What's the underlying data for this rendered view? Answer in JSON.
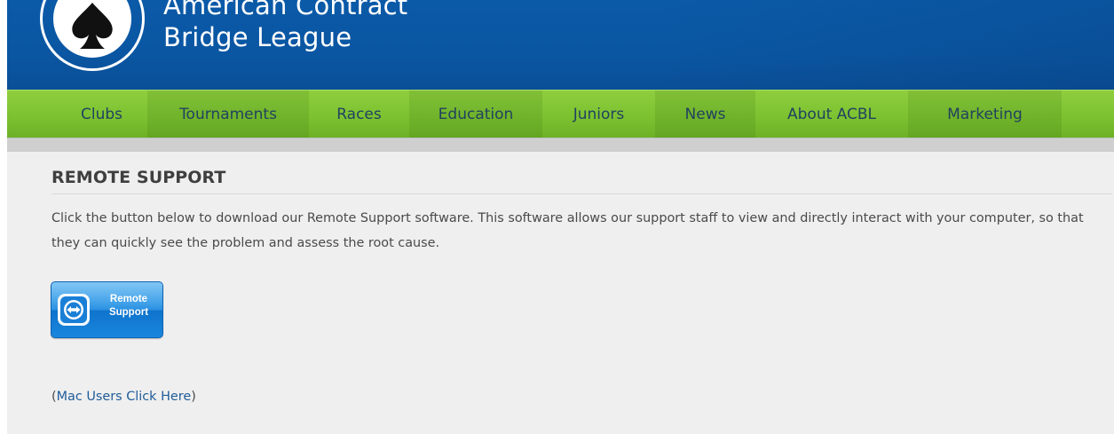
{
  "header": {
    "org_name_line1": "American Contract",
    "org_name_line2": "Bridge League",
    "logo_icon": "spade-icon",
    "colors": {
      "header_blue": "#0b5aa8",
      "nav_green": "#7cc231",
      "nav_text": "#22415f",
      "link": "#1f5c99"
    }
  },
  "nav": {
    "items": [
      {
        "label": "Clubs"
      },
      {
        "label": "Tournaments"
      },
      {
        "label": "Races"
      },
      {
        "label": "Education"
      },
      {
        "label": "Juniors"
      },
      {
        "label": "News"
      },
      {
        "label": "About ACBL"
      },
      {
        "label": "Marketing"
      }
    ]
  },
  "main": {
    "title": "REMOTE SUPPORT",
    "description": "Click the button below to download our Remote Support software. This software allows our support staff to view and directly interact with your computer, so that they can quickly see the problem and assess the root cause.",
    "remote_button": {
      "line1": "Remote",
      "line2": "Support",
      "icon": "remote-support-icon"
    },
    "mac_prefix": "(",
    "mac_link": "Mac Users Click Here",
    "mac_suffix": ")"
  }
}
